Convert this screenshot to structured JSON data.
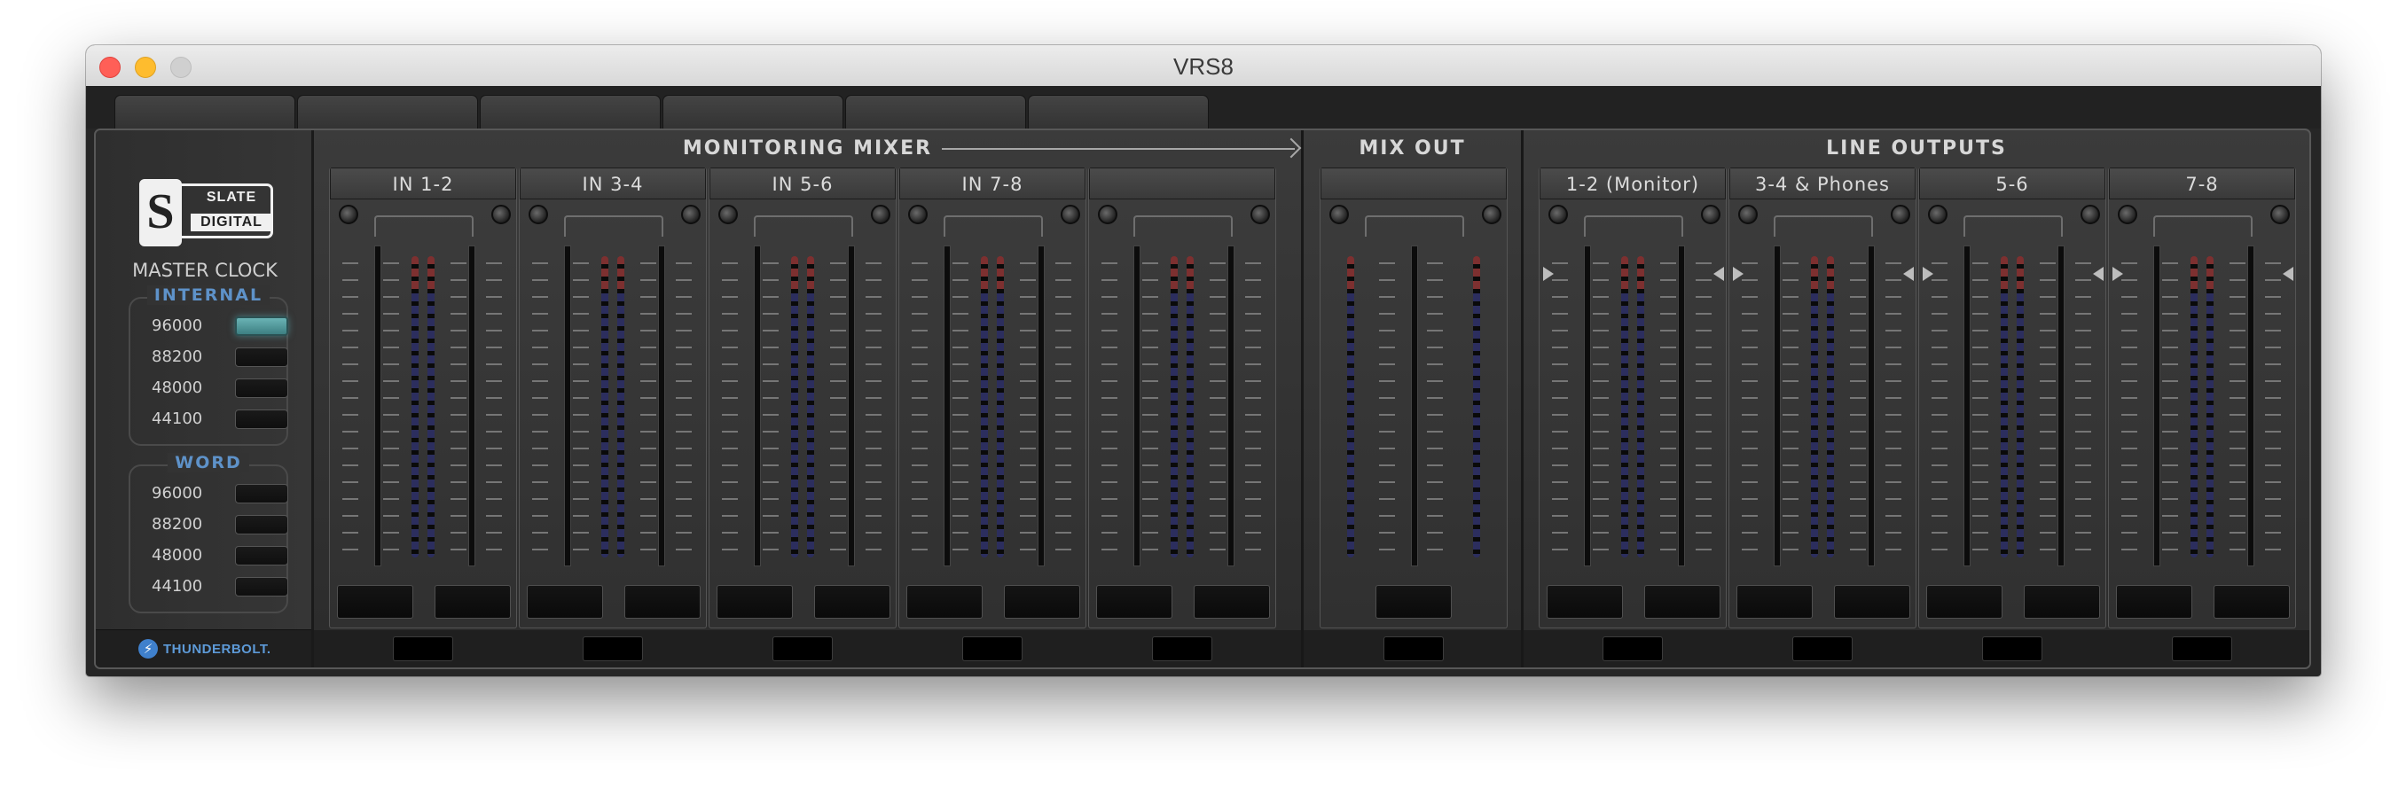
{
  "window": {
    "title": "VRS8",
    "tab_count": 6
  },
  "sidebar": {
    "brand_top": "SLATE",
    "brand_bottom": "DIGITAL",
    "brand_mark": "S",
    "clock_title": "MASTER CLOCK",
    "internal": {
      "label": "INTERNAL",
      "rates": [
        "96000",
        "88200",
        "48000",
        "44100"
      ],
      "selected": "96000"
    },
    "word": {
      "label": "WORD",
      "rates": [
        "96000",
        "88200",
        "48000",
        "44100"
      ],
      "selected": ""
    },
    "thunderbolt_label": "THUNDERBOLT."
  },
  "sections": {
    "monitoring": {
      "title": "MONITORING MIXER",
      "channels": [
        "IN 1-2",
        "IN 3-4",
        "IN 5-6",
        "IN 7-8",
        ""
      ]
    },
    "mix_out": {
      "title": "MIX OUT",
      "channels": [
        ""
      ]
    },
    "line_outputs": {
      "title": "LINE OUTPUTS",
      "channels": [
        "1-2 (Monitor)",
        "3-4 & Phones",
        "5-6",
        "7-8"
      ]
    }
  },
  "colors": {
    "selected_button": "#5ea7aa",
    "group_label": "#5e92c9",
    "meter_peak": "#7d3030",
    "meter_body": "#2c2e5e",
    "thunderbolt": "#3f80cc"
  }
}
